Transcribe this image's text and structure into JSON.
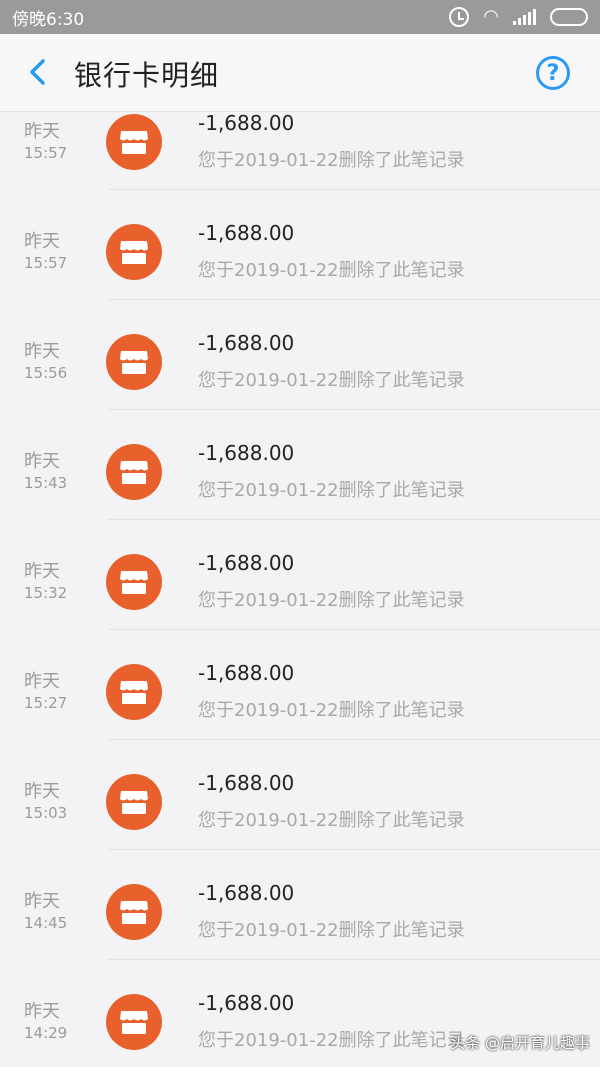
{
  "status_bar": {
    "time": "傍晚6:30",
    "battery_color": "#ff7a00",
    "icons": [
      "alarm-icon",
      "wifi-icon",
      "signal-icon",
      "battery-icon"
    ]
  },
  "nav": {
    "title": "银行卡明细",
    "back_icon": "chevron-left-icon",
    "help_icon": "question-circle-icon",
    "help_symbol": "?"
  },
  "transactions": [
    {
      "date": "昨天",
      "time": "15:57",
      "amount": "-1,688.00",
      "desc": "您于2019-01-22删除了此笔记录"
    },
    {
      "date": "昨天",
      "time": "15:57",
      "amount": "-1,688.00",
      "desc": "您于2019-01-22删除了此笔记录"
    },
    {
      "date": "昨天",
      "time": "15:56",
      "amount": "-1,688.00",
      "desc": "您于2019-01-22删除了此笔记录"
    },
    {
      "date": "昨天",
      "time": "15:43",
      "amount": "-1,688.00",
      "desc": "您于2019-01-22删除了此笔记录"
    },
    {
      "date": "昨天",
      "time": "15:32",
      "amount": "-1,688.00",
      "desc": "您于2019-01-22删除了此笔记录"
    },
    {
      "date": "昨天",
      "time": "15:27",
      "amount": "-1,688.00",
      "desc": "您于2019-01-22删除了此笔记录"
    },
    {
      "date": "昨天",
      "time": "15:03",
      "amount": "-1,688.00",
      "desc": "您于2019-01-22删除了此笔记录"
    },
    {
      "date": "昨天",
      "time": "14:45",
      "amount": "-1,688.00",
      "desc": "您于2019-01-22删除了此笔记录"
    },
    {
      "date": "昨天",
      "time": "14:29",
      "amount": "-1,688.00",
      "desc": "您于2019-01-22删除了此笔记录"
    }
  ],
  "watermark": "头条 @启开育儿趣事"
}
